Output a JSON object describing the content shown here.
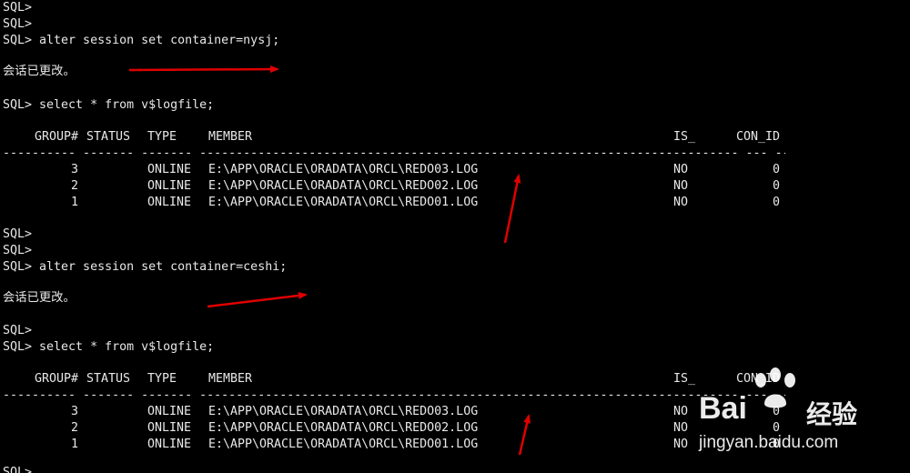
{
  "terminal": {
    "block1": {
      "prompts": [
        "SQL>",
        "SQL>"
      ],
      "alter_cmd": "SQL> alter session set container=nysj;",
      "result": "会话已更改。",
      "select_cmd": "SQL> select * from v$logfile;"
    },
    "block2": {
      "prompts": [
        "SQL>",
        "SQL>"
      ],
      "alter_cmd": "SQL> alter session set container=ceshi;",
      "result": "会话已更改。",
      "prompt_before_select": "SQL>",
      "select_cmd": "SQL> select * from v$logfile;"
    },
    "table": {
      "headers": [
        "GROUP#",
        "STATUS",
        "TYPE",
        "MEMBER",
        "IS_",
        "CON_ID"
      ],
      "separator": "---------- ------- ------- -------------------------------------------------------------------------- --- ----------",
      "rows": [
        {
          "group": "3",
          "status": "",
          "type": "ONLINE",
          "member": "E:\\APP\\ORACLE\\ORADATA\\ORCL\\REDO03.LOG",
          "is_": "NO",
          "con_id": "0"
        },
        {
          "group": "2",
          "status": "",
          "type": "ONLINE",
          "member": "E:\\APP\\ORACLE\\ORADATA\\ORCL\\REDO02.LOG",
          "is_": "NO",
          "con_id": "0"
        },
        {
          "group": "1",
          "status": "",
          "type": "ONLINE",
          "member": "E:\\APP\\ORACLE\\ORADATA\\ORCL\\REDO01.LOG",
          "is_": "NO",
          "con_id": "0"
        }
      ]
    }
  },
  "watermark": {
    "brand_left": "Bai",
    "brand_right": "经验",
    "url": "jingyan.baidu.com"
  },
  "colors": {
    "background": "#000000",
    "text": "#e8e8e8",
    "annotation_arrow": "#e00000"
  }
}
